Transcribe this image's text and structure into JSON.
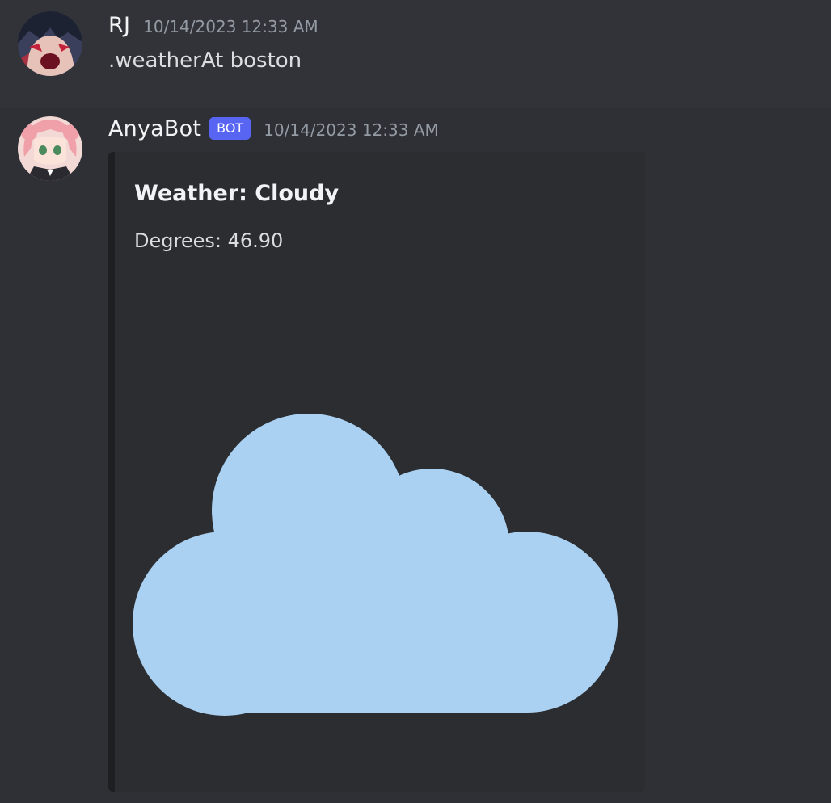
{
  "messages": [
    {
      "username": "RJ",
      "timestamp": "10/14/2023 12:33 AM",
      "text": ".weatherAt boston",
      "avatar_icon": "anime-avatar-dark-hair"
    },
    {
      "username": "AnyaBot",
      "badge": "BOT",
      "timestamp": "10/14/2023 12:33 AM",
      "avatar_icon": "anime-avatar-pink-hair",
      "embed": {
        "title": "Weather: Cloudy",
        "description": "Degrees: 46.90",
        "image_icon": "cloud-icon",
        "image_color": "#aad1f2"
      }
    }
  ],
  "colors": {
    "background": "#313338",
    "embed_background": "#2b2d31",
    "bot_badge": "#5865f2",
    "timestamp": "#949ba4"
  }
}
